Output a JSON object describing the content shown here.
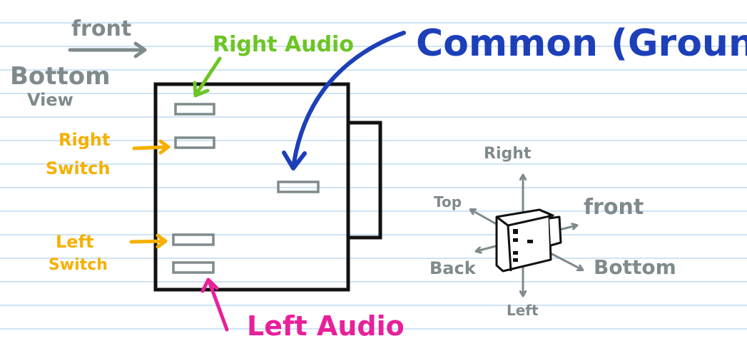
{
  "orientation": {
    "front": "front",
    "bottom": "Bottom",
    "view": "View"
  },
  "labels": {
    "right_audio": "Right Audio",
    "common_ground": "Common (Ground)",
    "right_switch_1": "Right",
    "right_switch_2": "Switch",
    "left_switch_1": "Left",
    "left_switch_2": "Switch",
    "left_audio": "Left Audio"
  },
  "axes": {
    "right": "Right",
    "top": "Top",
    "front": "front",
    "back": "Back",
    "bottom": "Bottom",
    "left": "Left"
  },
  "colors": {
    "gray": "#7f8a8c",
    "green": "#6cc524",
    "orange": "#f5b000",
    "pink": "#e8209a",
    "blue": "#1d3fb8",
    "outline": "#111111",
    "ruled_line": "#cfe3f3"
  }
}
